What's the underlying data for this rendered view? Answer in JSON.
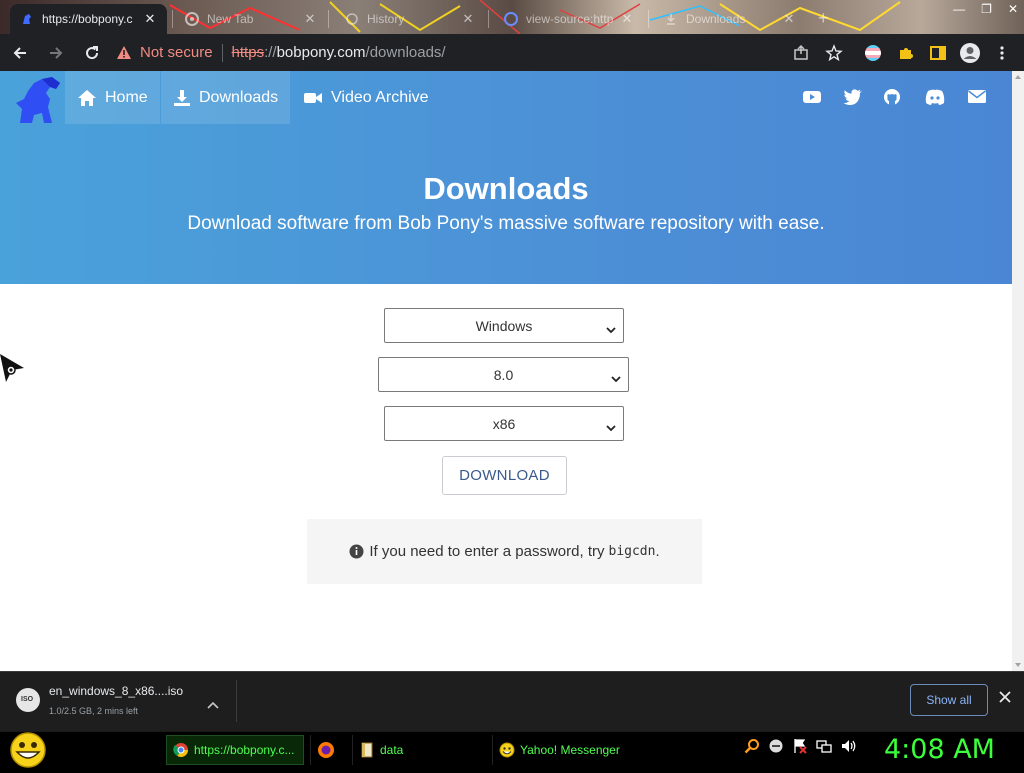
{
  "browser": {
    "tabs": [
      {
        "title": "https://bobpony.c",
        "active": true
      },
      {
        "title": "New Tab",
        "active": false
      },
      {
        "title": "History",
        "active": false
      },
      {
        "title": "view-source:http",
        "active": false
      },
      {
        "title": "Downloads",
        "active": false
      }
    ],
    "security_label": "Not secure",
    "url": {
      "scheme": "https",
      "separator": "://",
      "host": "bobpony.com",
      "path": "/downloads/"
    }
  },
  "site": {
    "nav": [
      {
        "label": "Home",
        "icon": "home-icon"
      },
      {
        "label": "Downloads",
        "icon": "download-icon"
      },
      {
        "label": "Video Archive",
        "icon": "video-camera-icon"
      }
    ],
    "social_icons": [
      "youtube-icon",
      "twitter-icon",
      "github-icon",
      "discord-icon",
      "mail-icon"
    ],
    "hero": {
      "title": "Downloads",
      "subtitle": "Download software from Bob Pony's massive software repository with ease."
    },
    "selects": {
      "os": "Windows",
      "version": "8.0",
      "arch": "x86"
    },
    "download_label": "DOWNLOAD",
    "notice": {
      "text": "If you need to enter a password, try",
      "code": "bigcdn",
      "end": "."
    }
  },
  "download_shelf": {
    "file_icon_text": "ISO",
    "filename": "en_windows_8_x86....iso",
    "status": "1.0/2.5 GB, 2 mins left",
    "show_all": "Show all"
  },
  "taskbar": {
    "tasks": [
      {
        "label": "https://bobpony.c...",
        "icon": "chrome-icon",
        "active": true
      },
      {
        "label": "",
        "icon": "firefox-icon",
        "active": false
      },
      {
        "label": "data",
        "icon": "folder-icon",
        "active": false
      },
      {
        "label": "Yahoo! Messenger",
        "icon": "yahoo-messenger-icon",
        "active": false
      }
    ],
    "clock": "4:08 AM"
  },
  "colors": {
    "hero_gradient_start": "#4aa2da",
    "hero_gradient_end": "#4a86d4",
    "not_secure": "#f28b82",
    "taskbar_text": "#50ff50",
    "clock": "#3cff3c"
  }
}
